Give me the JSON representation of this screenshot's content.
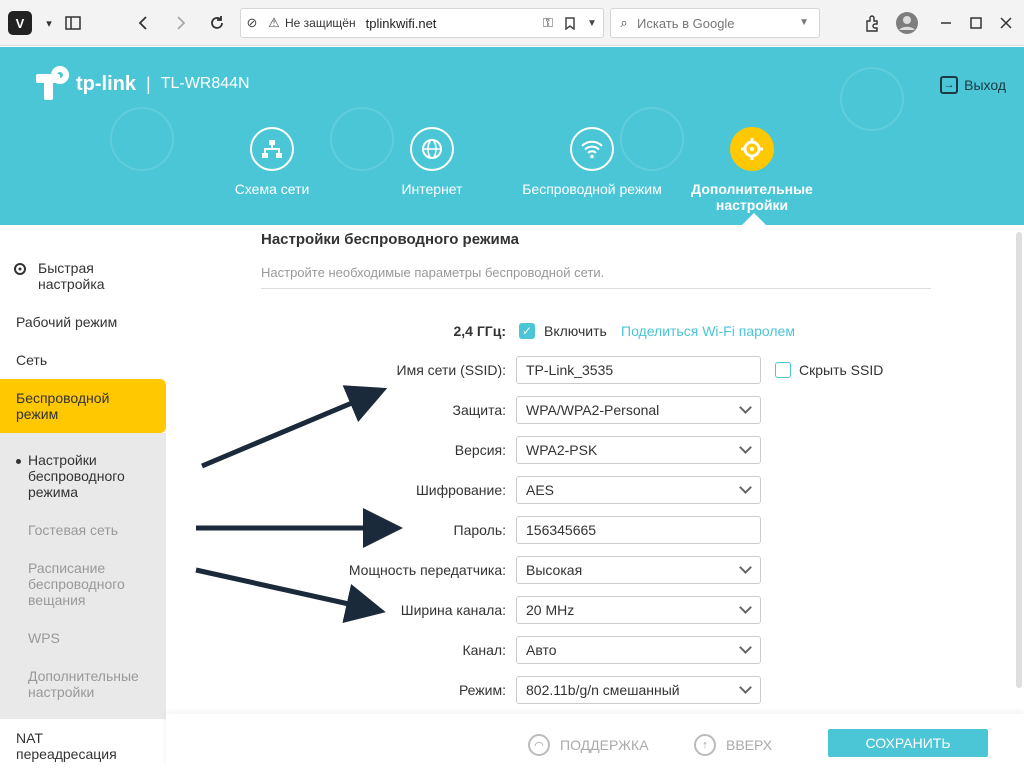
{
  "browser": {
    "security_text": "Не защищён",
    "url": "tplinkwifi.net",
    "search_placeholder": "Искать в Google"
  },
  "header": {
    "brand": "tp-link",
    "model": "TL-WR844N",
    "logout": "Выход",
    "tabs": [
      {
        "label": "Схема сети",
        "icon": "network-map-icon"
      },
      {
        "label": "Интернет",
        "icon": "globe-icon"
      },
      {
        "label": "Беспроводной режим",
        "icon": "wifi-icon"
      },
      {
        "label": "Дополнительные настройки",
        "icon": "gear-icon",
        "active": true
      }
    ]
  },
  "sidebar": {
    "items": [
      {
        "label": "Быстрая настройка"
      },
      {
        "label": "Рабочий режим"
      },
      {
        "label": "Сеть"
      },
      {
        "label": "Беспроводной режим",
        "active": true
      },
      {
        "label": "NAT переадресация"
      }
    ],
    "sub_items": [
      {
        "label": "Настройки беспроводного режима",
        "current": true
      },
      {
        "label": "Гостевая сеть"
      },
      {
        "label": "Расписание беспроводного вещания"
      },
      {
        "label": "WPS"
      },
      {
        "label": "Дополнительные настройки"
      }
    ]
  },
  "main": {
    "title": "Настройки беспроводного режима",
    "subtitle": "Настройте необходимые параметры беспроводной сети.",
    "band_label": "2,4 ГГц:",
    "enable_label": "Включить",
    "share_link": "Поделиться Wi-Fi паролем",
    "hide_ssid_label": "Скрыть SSID",
    "fields": [
      {
        "label": "Имя сети (SSID):",
        "value": "TP-Link_3535",
        "type": "text"
      },
      {
        "label": "Защита:",
        "value": "WPA/WPA2-Personal",
        "type": "select"
      },
      {
        "label": "Версия:",
        "value": "WPA2-PSK",
        "type": "select"
      },
      {
        "label": "Шифрование:",
        "value": "AES",
        "type": "select"
      },
      {
        "label": "Пароль:",
        "value": "156345665",
        "type": "text"
      },
      {
        "label": "Мощность передатчика:",
        "value": "Высокая",
        "type": "select"
      },
      {
        "label": "Ширина канала:",
        "value": "20 MHz",
        "type": "select"
      },
      {
        "label": "Канал:",
        "value": "Авто",
        "type": "select"
      },
      {
        "label": "Режим:",
        "value": "802.11b/g/n смешанный",
        "type": "select"
      }
    ]
  },
  "footer": {
    "support": "ПОДДЕРЖКА",
    "up": "ВВЕРХ",
    "save": "СОХРАНИТЬ"
  },
  "colors": {
    "accent": "#4ac6d6",
    "active": "#ffc800",
    "arrow": "#1b2a3a"
  }
}
